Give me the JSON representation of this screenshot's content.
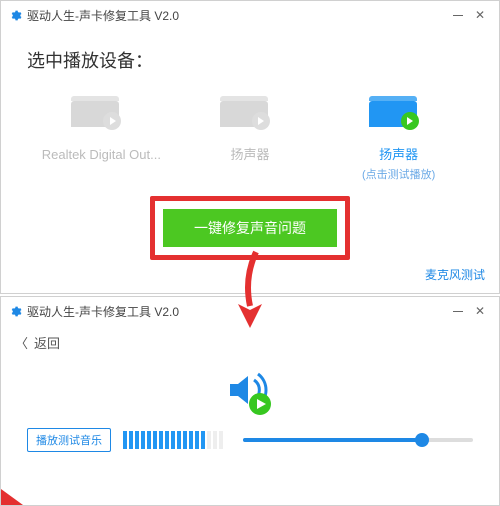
{
  "title": "驱动人生-声卡修复工具 V2.0",
  "colors": {
    "accent": "#2196f3",
    "success": "#4cc822",
    "highlight": "#e43030"
  },
  "win1": {
    "heading": "选中播放设备：",
    "devices": [
      {
        "label": "Realtek Digital Out...",
        "sub": "",
        "active": false
      },
      {
        "label": "扬声器",
        "sub": "",
        "active": false
      },
      {
        "label": "扬声器",
        "sub": "(点击测试播放)",
        "active": true
      }
    ],
    "fix_button": "一键修复声音问题",
    "mic_test": "麦克风测试"
  },
  "win2": {
    "back": "返回",
    "play_music": "播放测试音乐",
    "volume_percent": 78
  }
}
